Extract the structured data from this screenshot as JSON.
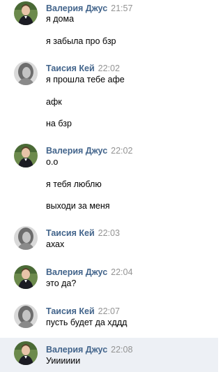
{
  "groups": [
    {
      "author": "Валерия Джус",
      "time": "21:57",
      "avatar": "valeria",
      "messages": [
        "я дома",
        "я забыла про бзр"
      ]
    },
    {
      "author": "Таисия Кей",
      "time": "22:02",
      "avatar": "taisia",
      "messages": [
        "я прошла тебе афе",
        "афк",
        "на бзр"
      ]
    },
    {
      "author": "Валерия Джус",
      "time": "22:02",
      "avatar": "valeria",
      "messages": [
        "о.о",
        "я тебя люблю",
        "выходи за меня"
      ]
    },
    {
      "author": "Таисия Кей",
      "time": "22:03",
      "avatar": "taisia",
      "messages": [
        "ахах"
      ]
    },
    {
      "author": "Валерия Джус",
      "time": "22:04",
      "avatar": "valeria",
      "messages": [
        "это да?"
      ]
    },
    {
      "author": "Таисия Кей",
      "time": "22:07",
      "avatar": "taisia",
      "messages": [
        "пусть будет да хддд"
      ]
    },
    {
      "author": "Валерия Джус",
      "time": "22:08",
      "avatar": "valeria",
      "highlighted": true,
      "messages": [
        "Уииииии"
      ]
    }
  ],
  "colors": {
    "author": "#42648b",
    "time": "#939393",
    "highlight": "#edf0f5"
  }
}
